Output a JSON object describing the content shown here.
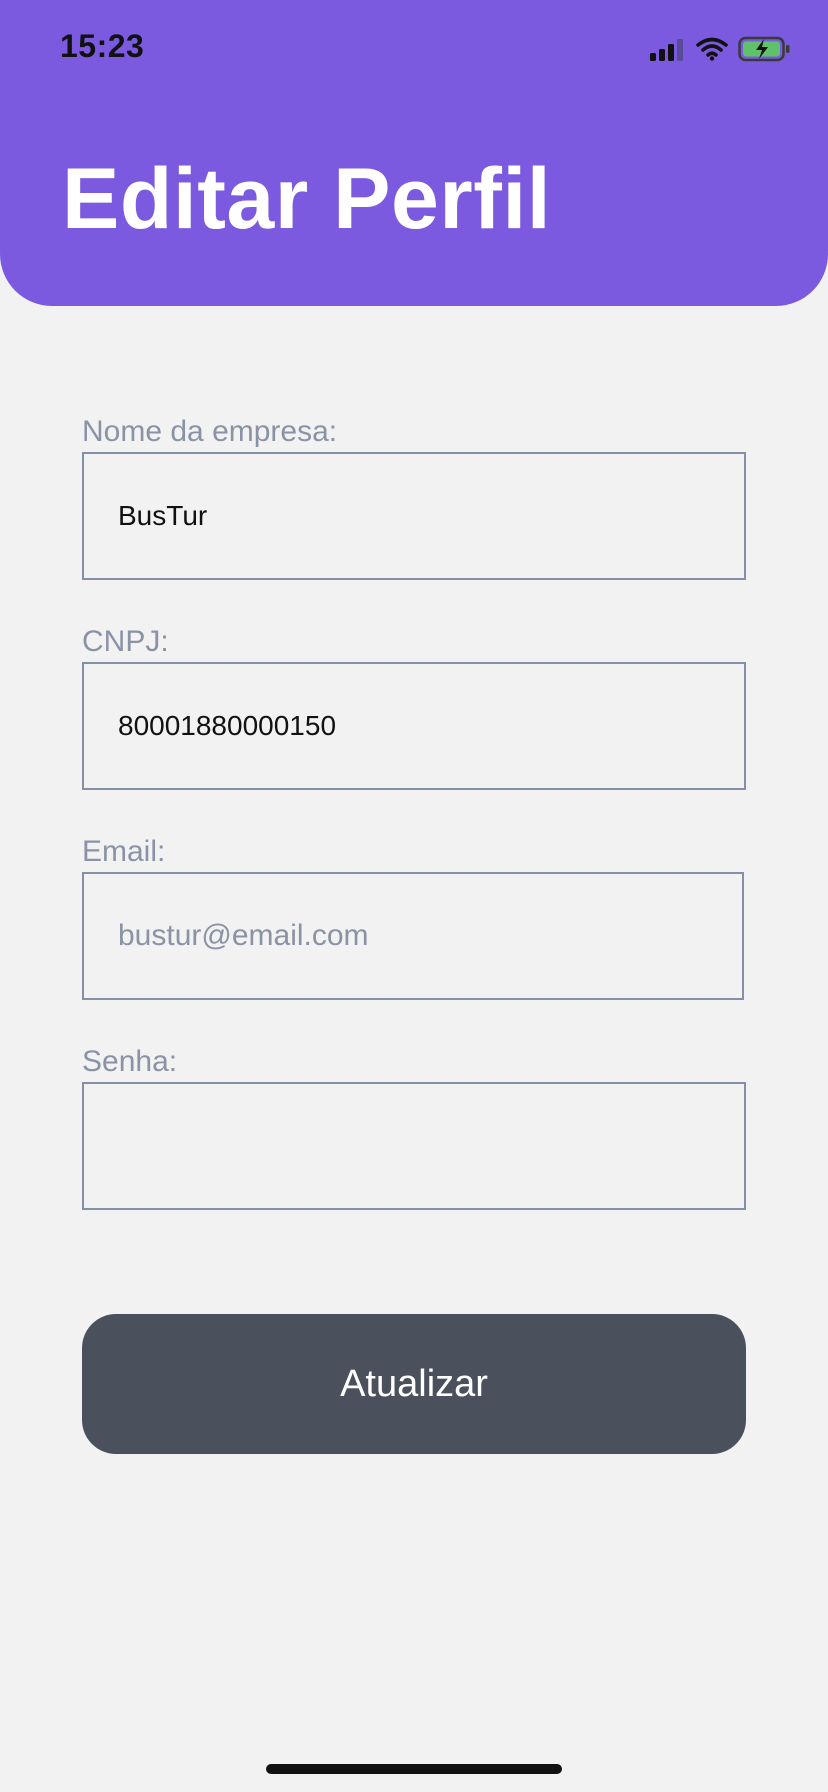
{
  "status_bar": {
    "time": "15:23",
    "icons": [
      "signal-icon",
      "wifi-icon",
      "battery-charging-icon"
    ]
  },
  "header": {
    "title": "Editar Perfil",
    "background_color": "#7b5ae0"
  },
  "form": {
    "company_name": {
      "label": "Nome da empresa:",
      "value": "BusTur"
    },
    "cnpj": {
      "label": "CNPJ:",
      "value": "80001880000150"
    },
    "email": {
      "label": "Email:",
      "value": "",
      "placeholder": "bustur@email.com"
    },
    "password": {
      "label": "Senha:",
      "value": ""
    }
  },
  "actions": {
    "submit_label": "Atualizar",
    "submit_color": "#4b515c"
  }
}
